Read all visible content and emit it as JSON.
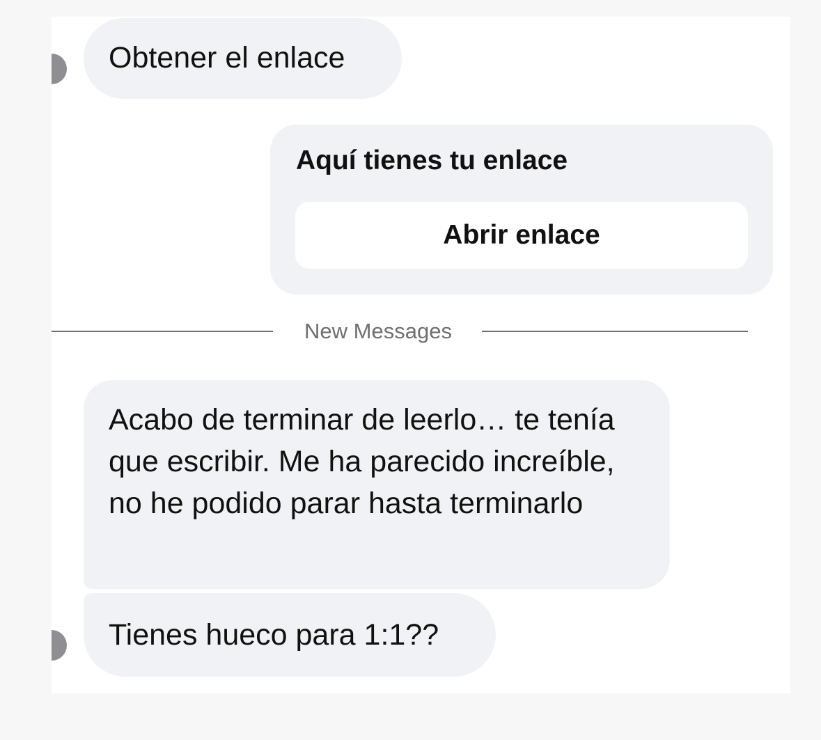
{
  "messages": {
    "m1": "Obtener el enlace",
    "card": {
      "title": "Aquí tienes tu enlace",
      "button_label": "Abrir enlace"
    },
    "divider_label": "New Messages",
    "m2": "Acabo de terminar de leerlo… te tenía que escribir. Me ha parecido increíble, no he podido parar hasta terminarlo",
    "m3": "Tienes hueco para 1:1??"
  }
}
